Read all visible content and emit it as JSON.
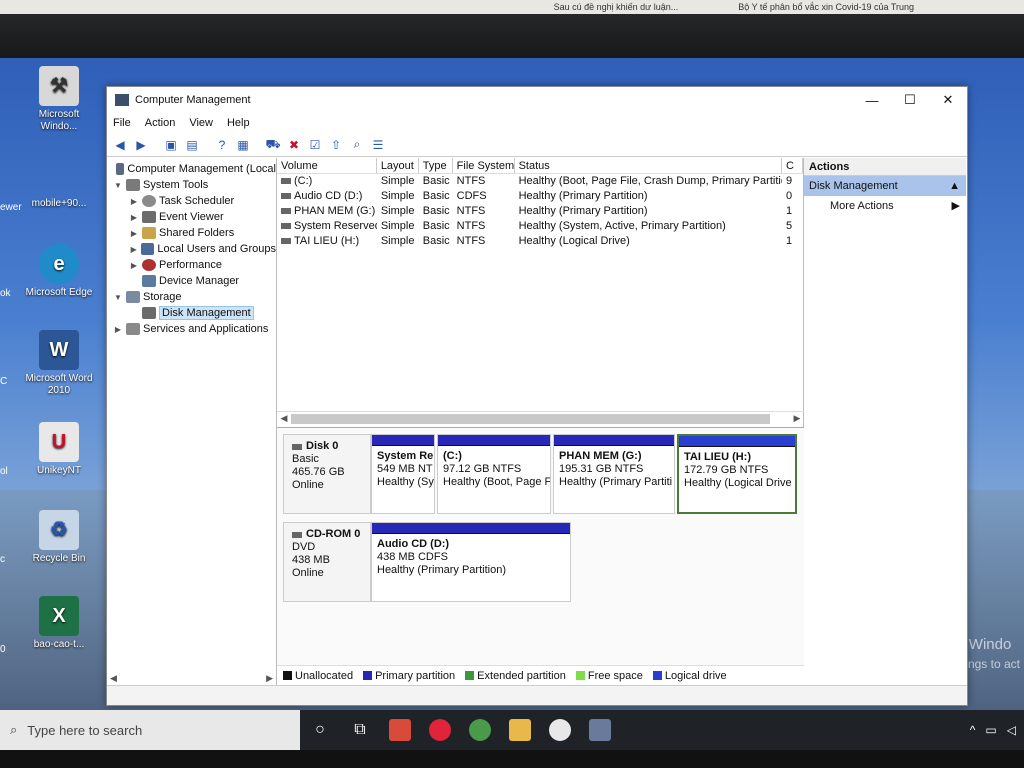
{
  "browser_strip": {
    "text1": "Sau cú đề nghị khiến dư luận...",
    "text2": "Bộ Y tế phân bổ vắc xin Covid-19 của Trung"
  },
  "desktop": {
    "icons": [
      {
        "label": "Microsoft Windo...",
        "icon": "windows-tool-icon",
        "color": "#d8d8d8"
      },
      {
        "label": "mobile+90...",
        "icon": "file-icon",
        "color": "#cfd6e0"
      },
      {
        "label": "Microsoft Edge",
        "icon": "edge-icon",
        "color": "#1f8cc9"
      },
      {
        "label": "Microsoft Word 2010",
        "icon": "word-icon",
        "color": "#2b5797"
      },
      {
        "label": "UnikeyNT",
        "icon": "unikey-icon",
        "color": "#e8e8e8"
      },
      {
        "label": "Recycle Bin",
        "icon": "recycle-bin-icon",
        "color": "#c6d6e6"
      },
      {
        "label": "bao-cao-t...",
        "icon": "excel-icon",
        "color": "#1e7145"
      }
    ],
    "left_edge_labels": [
      "ewer",
      "ok",
      "C",
      "ol",
      "c",
      "0"
    ],
    "activate_line1": "Activate Windo",
    "activate_line2": "Go to Settings to act"
  },
  "window": {
    "title": "Computer Management",
    "controls": {
      "minimize": "—",
      "maximize": "☐",
      "close": "✕"
    },
    "menu": [
      "File",
      "Action",
      "View",
      "Help"
    ]
  },
  "tree": {
    "root": "Computer Management (Local",
    "system_tools": "System Tools",
    "items": [
      "Task Scheduler",
      "Event Viewer",
      "Shared Folders",
      "Local Users and Groups",
      "Performance",
      "Device Manager"
    ],
    "storage": "Storage",
    "disk_management": "Disk Management",
    "services": "Services and Applications"
  },
  "volumes": {
    "headers": [
      "Volume",
      "Layout",
      "Type",
      "File System",
      "Status",
      "C"
    ],
    "rows": [
      {
        "volume": "(C:)",
        "layout": "Simple",
        "type": "Basic",
        "fs": "NTFS",
        "status": "Healthy (Boot, Page File, Crash Dump, Primary Partition)",
        "c": "9"
      },
      {
        "volume": "Audio CD (D:)",
        "layout": "Simple",
        "type": "Basic",
        "fs": "CDFS",
        "status": "Healthy (Primary Partition)",
        "c": "0"
      },
      {
        "volume": "PHAN MEM (G:)",
        "layout": "Simple",
        "type": "Basic",
        "fs": "NTFS",
        "status": "Healthy (Primary Partition)",
        "c": "1"
      },
      {
        "volume": "System Reserved",
        "layout": "Simple",
        "type": "Basic",
        "fs": "NTFS",
        "status": "Healthy (System, Active, Primary Partition)",
        "c": "5"
      },
      {
        "volume": "TAI LIEU (H:)",
        "layout": "Simple",
        "type": "Basic",
        "fs": "NTFS",
        "status": "Healthy (Logical Drive)",
        "c": "1"
      }
    ]
  },
  "disks": {
    "disk0": {
      "name": "Disk 0",
      "type": "Basic",
      "size": "465.76 GB",
      "state": "Online"
    },
    "disk0_parts": [
      {
        "name": "System Re",
        "size": "549 MB NT",
        "status": "Healthy (Sy",
        "color": "#2828b8"
      },
      {
        "name": "(C:)",
        "size": "97.12 GB NTFS",
        "status": "Healthy (Boot, Page Fi",
        "color": "#2828b8"
      },
      {
        "name": "PHAN MEM  (G:)",
        "size": "195.31 GB NTFS",
        "status": "Healthy (Primary Partiti",
        "color": "#2828b8"
      },
      {
        "name": "TAI LIEU  (H:)",
        "size": "172.79 GB NTFS",
        "status": "Healthy (Logical Drive",
        "color": "#2a3fd0"
      }
    ],
    "cdrom0": {
      "name": "CD-ROM 0",
      "type": "DVD",
      "size": "438 MB",
      "state": "Online"
    },
    "cdrom0_part": {
      "name": "Audio CD  (D:)",
      "size": "438 MB CDFS",
      "status": "Healthy (Primary Partition)",
      "color": "#2828b8"
    }
  },
  "legend": [
    {
      "label": "Unallocated",
      "color": "#111111"
    },
    {
      "label": "Primary partition",
      "color": "#2828b8"
    },
    {
      "label": "Extended partition",
      "color": "#3a9a3a"
    },
    {
      "label": "Free space",
      "color": "#7fdc4a"
    },
    {
      "label": "Logical drive",
      "color": "#2a3fd0"
    }
  ],
  "actions": {
    "header": "Actions",
    "section": "Disk Management",
    "more": "More Actions"
  },
  "taskbar": {
    "search_placeholder": "Type here to search"
  }
}
